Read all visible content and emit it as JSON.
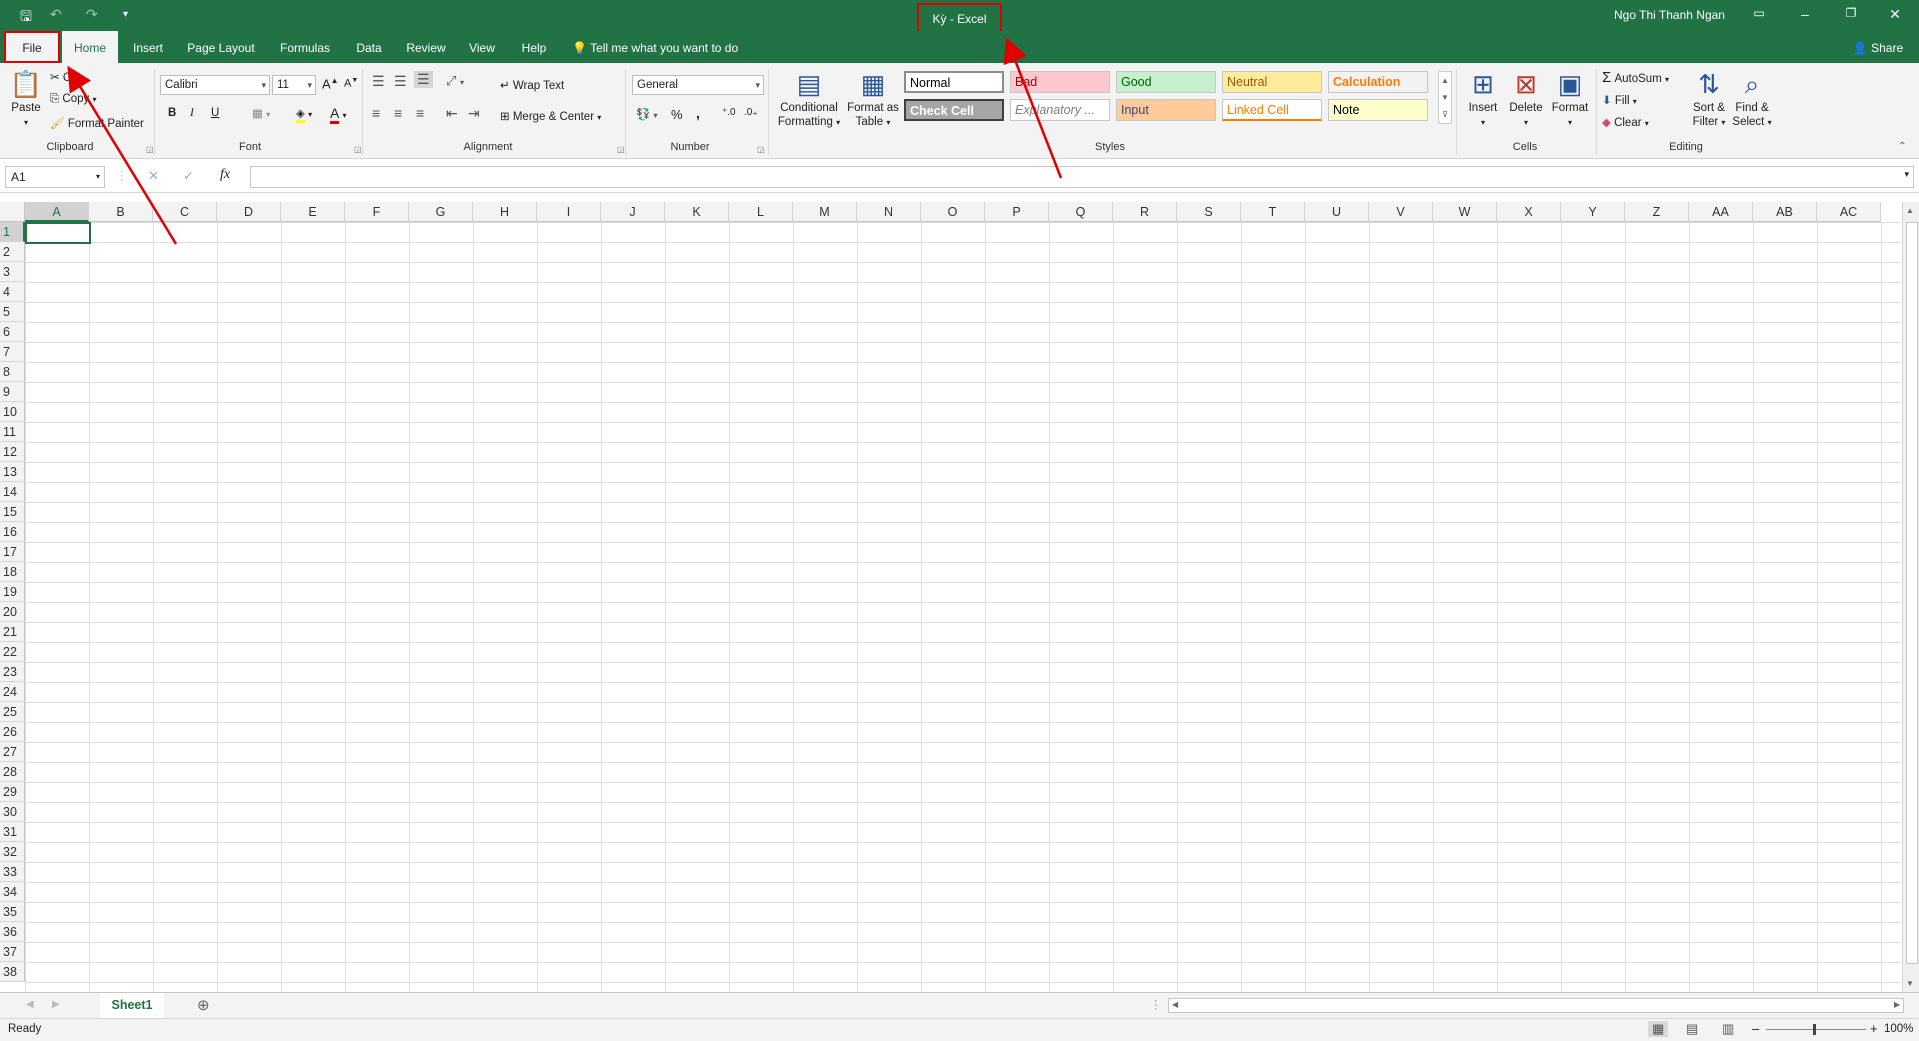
{
  "window": {
    "title": "Kỳ  -  Excel",
    "user": "Ngo Thi Thanh Ngan",
    "share": "Share"
  },
  "tabs": [
    "File",
    "Home",
    "Insert",
    "Page Layout",
    "Formulas",
    "Data",
    "Review",
    "View",
    "Help"
  ],
  "tell_me": "Tell me what you want to do",
  "clipboard": {
    "paste": "Paste",
    "cut": "Cut",
    "copy": "Copy",
    "format_painter": "Format Painter",
    "label": "Clipboard"
  },
  "font": {
    "name": "Calibri",
    "size": "11",
    "bold": "B",
    "italic": "I",
    "underline": "U",
    "label": "Font"
  },
  "alignment": {
    "wrap": "Wrap Text",
    "merge": "Merge & Center",
    "label": "Alignment"
  },
  "number": {
    "format": "General",
    "percent": "%",
    "comma": ",",
    "label": "Number"
  },
  "styles": {
    "conditional": "Conditional",
    "conditional2": "Formatting",
    "format_table": "Format as",
    "format_table2": "Table",
    "cells": [
      {
        "text": "Normal",
        "bg": "#ffffff",
        "fg": "#000000"
      },
      {
        "text": "Bad",
        "bg": "#ffc7ce",
        "fg": "#9c0006"
      },
      {
        "text": "Good",
        "bg": "#c6efce",
        "fg": "#006100"
      },
      {
        "text": "Neutral",
        "bg": "#ffeb9c",
        "fg": "#9c5700"
      },
      {
        "text": "Calculation",
        "bg": "#f2f2f2",
        "fg": "#fa7d00"
      },
      {
        "text": "Check Cell",
        "bg": "#a5a5a5",
        "fg": "#ffffff"
      },
      {
        "text": "Explanatory ...",
        "bg": "#ffffff",
        "fg": "#7f7f7f"
      },
      {
        "text": "Input",
        "bg": "#ffcc99",
        "fg": "#3f3f76"
      },
      {
        "text": "Linked Cell",
        "bg": "#ffffff",
        "fg": "#fa7d00"
      },
      {
        "text": "Note",
        "bg": "#ffffcc",
        "fg": "#000000"
      }
    ],
    "label": "Styles"
  },
  "cells_group": {
    "insert": "Insert",
    "delete": "Delete",
    "format": "Format",
    "label": "Cells"
  },
  "editing": {
    "autosum": "AutoSum",
    "fill": "Fill",
    "clear": "Clear",
    "sort": "Sort &",
    "sort2": "Filter",
    "find": "Find &",
    "find2": "Select",
    "label": "Editing"
  },
  "formula_bar": {
    "name_box": "A1",
    "fx": "fx"
  },
  "columns": [
    "A",
    "B",
    "C",
    "D",
    "E",
    "F",
    "G",
    "H",
    "I",
    "J",
    "K",
    "L",
    "M",
    "N",
    "O",
    "P",
    "Q",
    "R",
    "S",
    "T",
    "U",
    "V",
    "W",
    "X",
    "Y",
    "Z",
    "AA",
    "AB",
    "AC"
  ],
  "rows": [
    "1",
    "2",
    "3",
    "4",
    "5",
    "6",
    "7",
    "8",
    "9",
    "10",
    "11",
    "12",
    "13",
    "14",
    "15",
    "16",
    "17",
    "18",
    "19",
    "20",
    "21",
    "22",
    "23",
    "24",
    "25",
    "26",
    "27",
    "28",
    "29",
    "30",
    "31",
    "32",
    "33",
    "34",
    "35",
    "36",
    "37",
    "38"
  ],
  "sheet": {
    "name": "Sheet1"
  },
  "status": {
    "ready": "Ready",
    "zoom": "100%"
  },
  "colors": {
    "brand": "#217346",
    "annotation": "#e00000"
  }
}
